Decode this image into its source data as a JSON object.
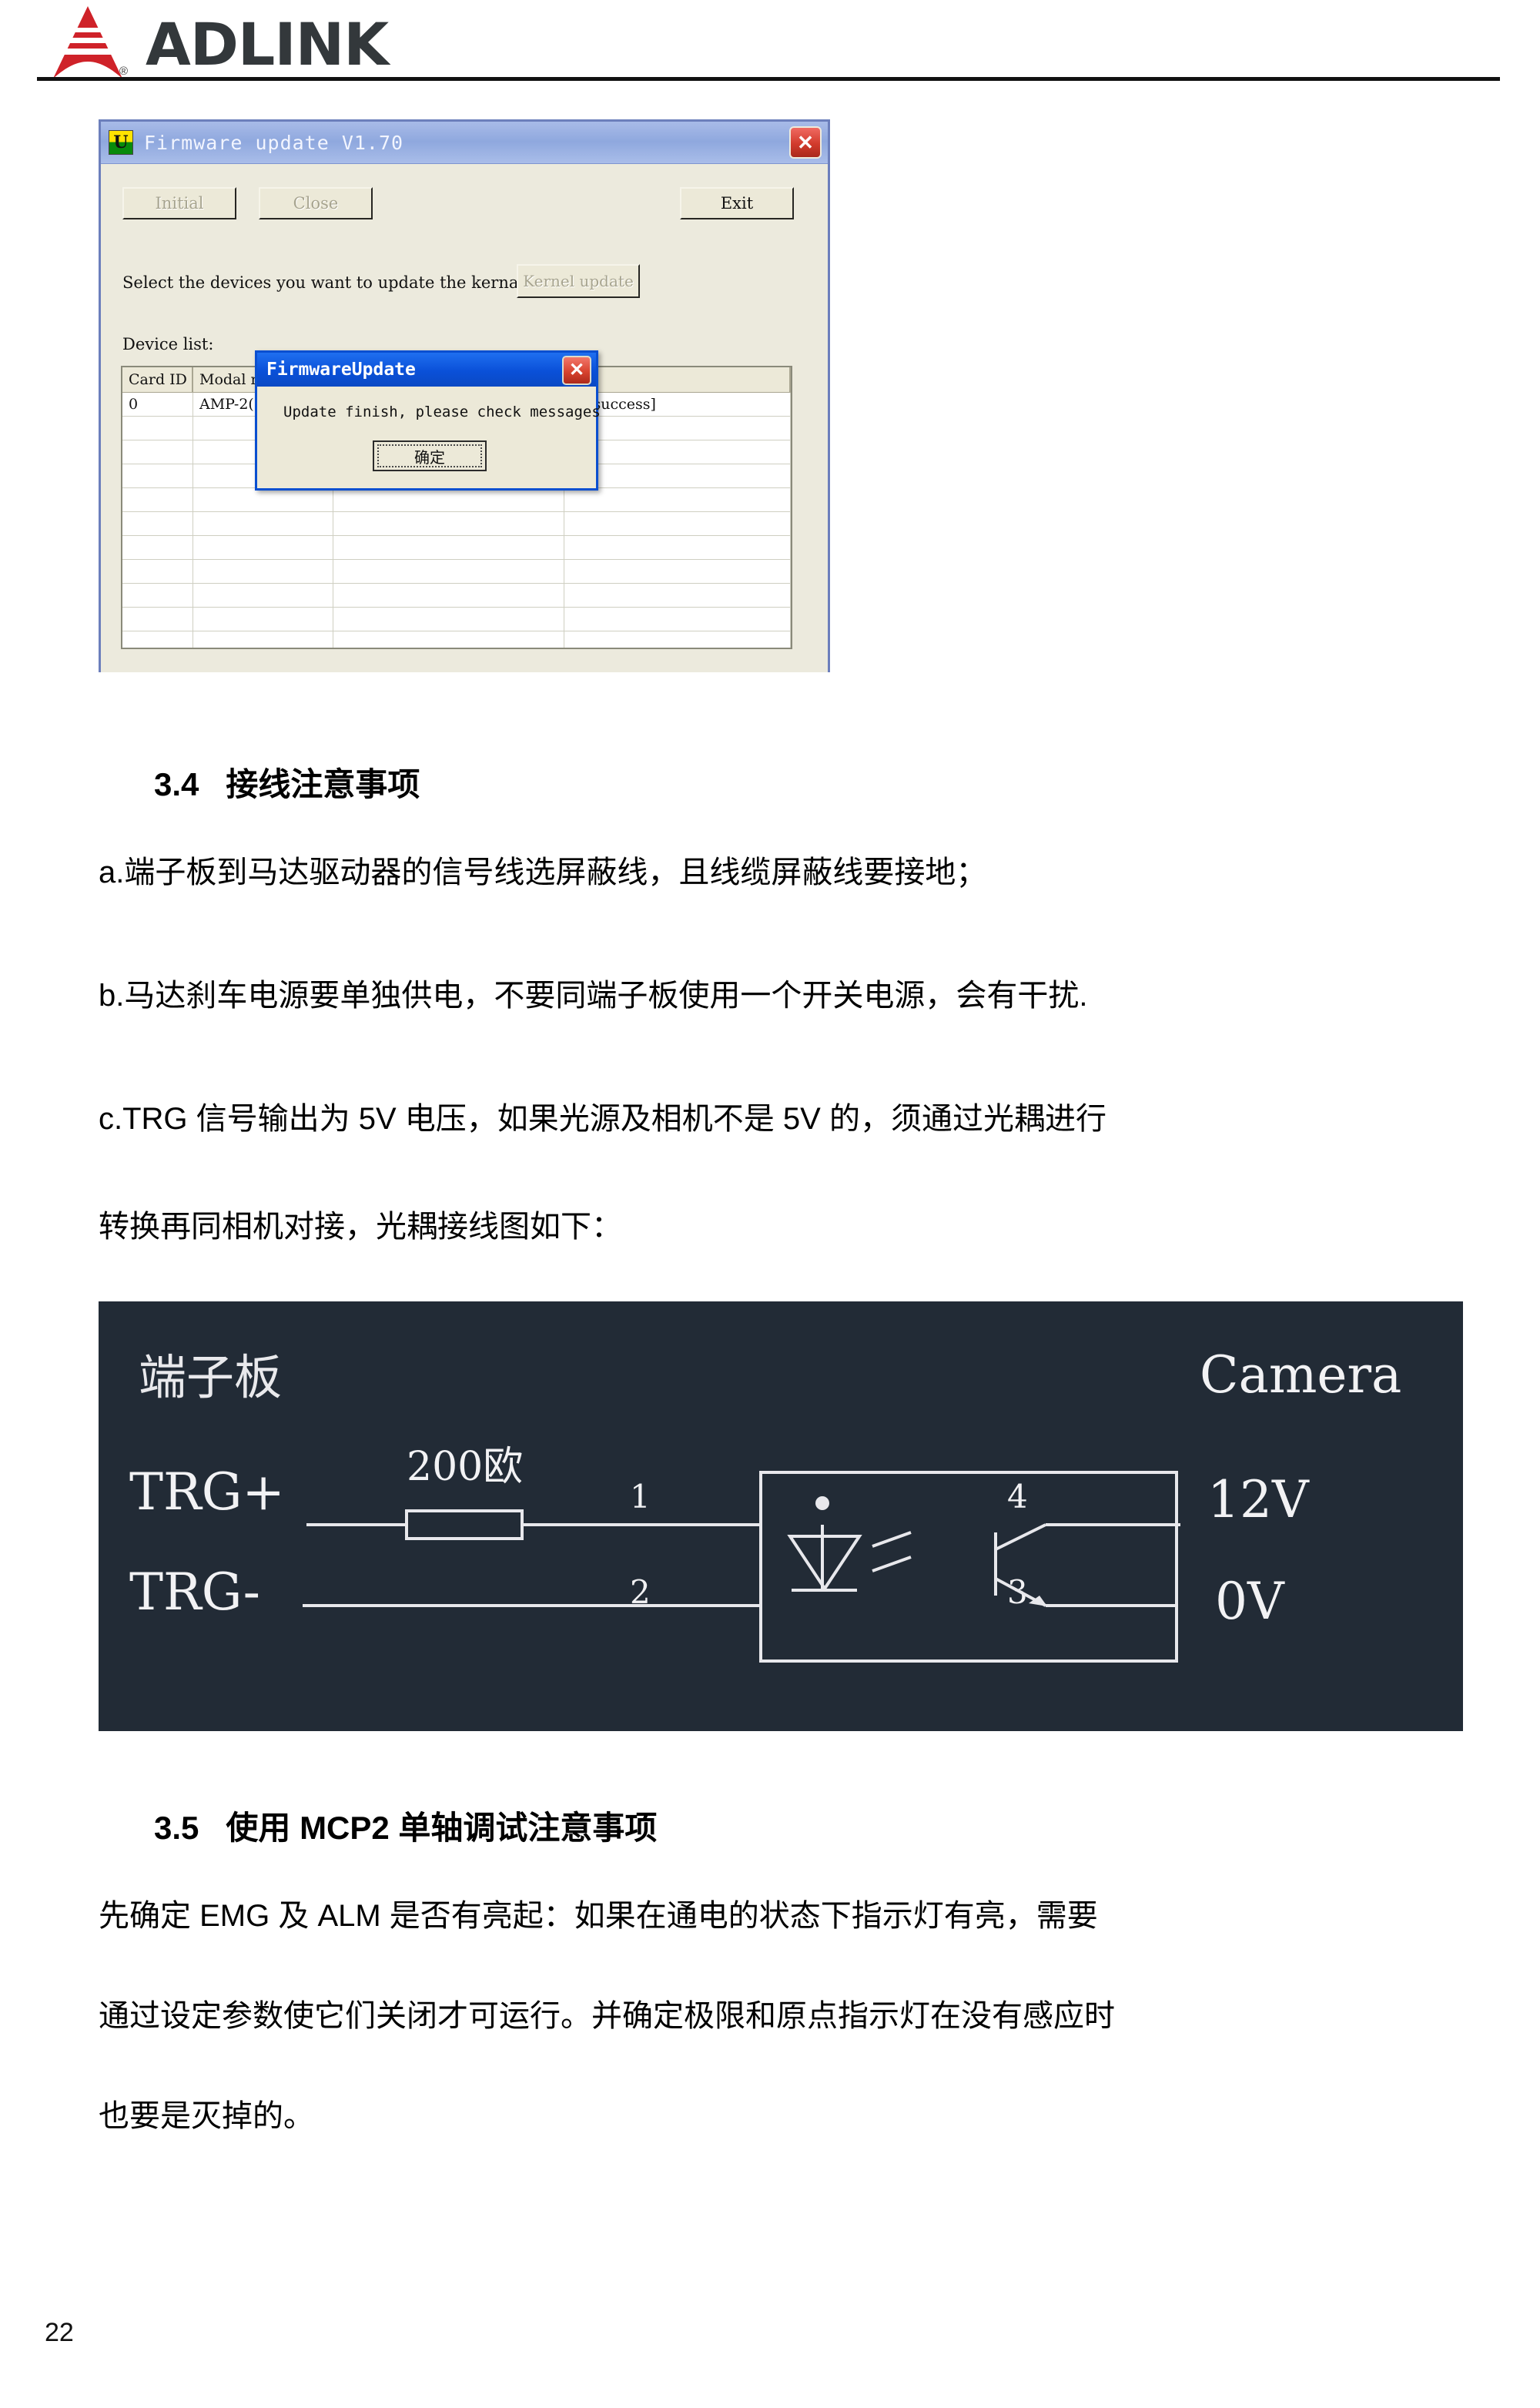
{
  "header": {
    "brand": "ADLINK",
    "registered_mark": "®"
  },
  "screenshot": {
    "window": {
      "title": "Firmware update V1.70",
      "icon": "firmware-update-icon",
      "icon_glyph": "U",
      "close_label": "✕",
      "buttons": {
        "initial": "Initial",
        "close": "Close",
        "exit": "Exit",
        "kernel_update": "Kernel update"
      },
      "hint": "Select the devices you want to update the kernal.",
      "device_list_label": "Device list:",
      "table": {
        "columns": [
          "Card ID",
          "Modal n",
          "",
          ""
        ],
        "rows": [
          [
            "0",
            "AMP-2(",
            "",
            "ad success]"
          ]
        ],
        "empty_rows": 11
      }
    },
    "modal": {
      "title": "FirmwareUpdate",
      "close_label": "✕",
      "message": "Update finish, please check messages",
      "ok_button": "确定"
    }
  },
  "sections": {
    "s34": {
      "number": "3.4",
      "title": "接线注意事项",
      "paragraphs": [
        "a.端子板到马达驱动器的信号线选屏蔽线，且线缆屏蔽线要接地；",
        "b.马达刹车电源要单独供电，不要同端子板使用一个开关电源，会有干扰.",
        "c.TRG 信号输出为 5V 电压，如果光源及相机不是 5V 的，须通过光耦进行",
        "转换再同相机对接，光耦接线图如下："
      ]
    },
    "s35": {
      "number": "3.5",
      "title": "使用 MCP2 单轴调试注意事项",
      "paragraphs": [
        "先确定 EMG 及 ALM 是否有亮起：如果在通电的状态下指示灯有亮，需要",
        "通过设定参数使它们关闭才可运行。并确定极限和原点指示灯在没有感应时",
        "也要是灭掉的。"
      ]
    }
  },
  "circuit": {
    "left_title": "端子板",
    "right_title": "Camera",
    "terminal_positive": "TRG+",
    "terminal_negative": "TRG-",
    "resistor": "200欧",
    "pin_1": "1",
    "pin_2": "2",
    "pin_3": "3",
    "pin_4": "4",
    "camera_positive": "12V",
    "camera_negative": "0V",
    "background_color": "#222b36",
    "line_color": "#e8e8ec"
  },
  "footer": {
    "page_number": "22"
  }
}
